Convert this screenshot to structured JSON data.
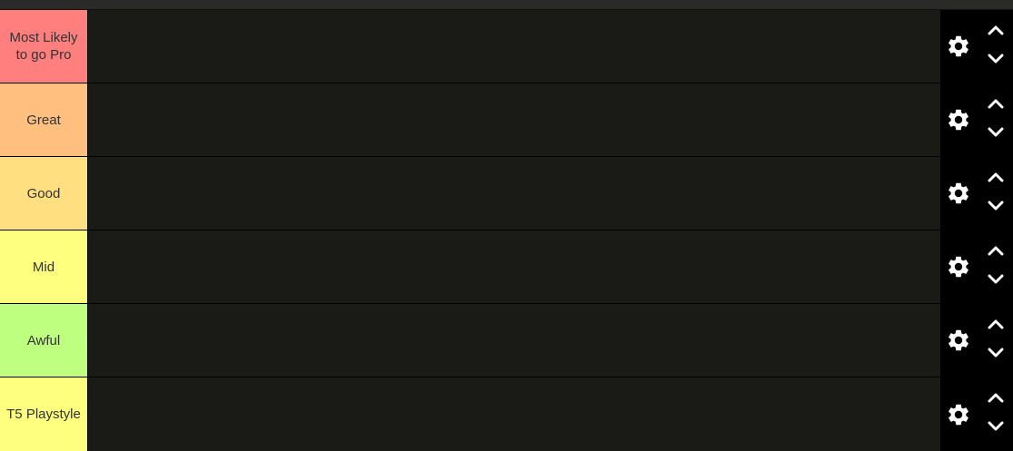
{
  "tiers": [
    {
      "label": "Most Likely\nto go Pro",
      "color": "#ff7f7f"
    },
    {
      "label": "Great",
      "color": "#ffbf7f"
    },
    {
      "label": "Good",
      "color": "#ffdf7f"
    },
    {
      "label": "Mid",
      "color": "#ffff7f"
    },
    {
      "label": "Awful",
      "color": "#bfff7f"
    },
    {
      "label": "T5 Playstyle",
      "color": "#ffff7f"
    }
  ],
  "icons": {
    "settings": "gear-icon",
    "move_up": "chevron-up-icon",
    "move_down": "chevron-down-icon"
  },
  "colors": {
    "row_background": "#1a1a17",
    "controls_background": "#000000",
    "icon_color": "#ffffff"
  }
}
